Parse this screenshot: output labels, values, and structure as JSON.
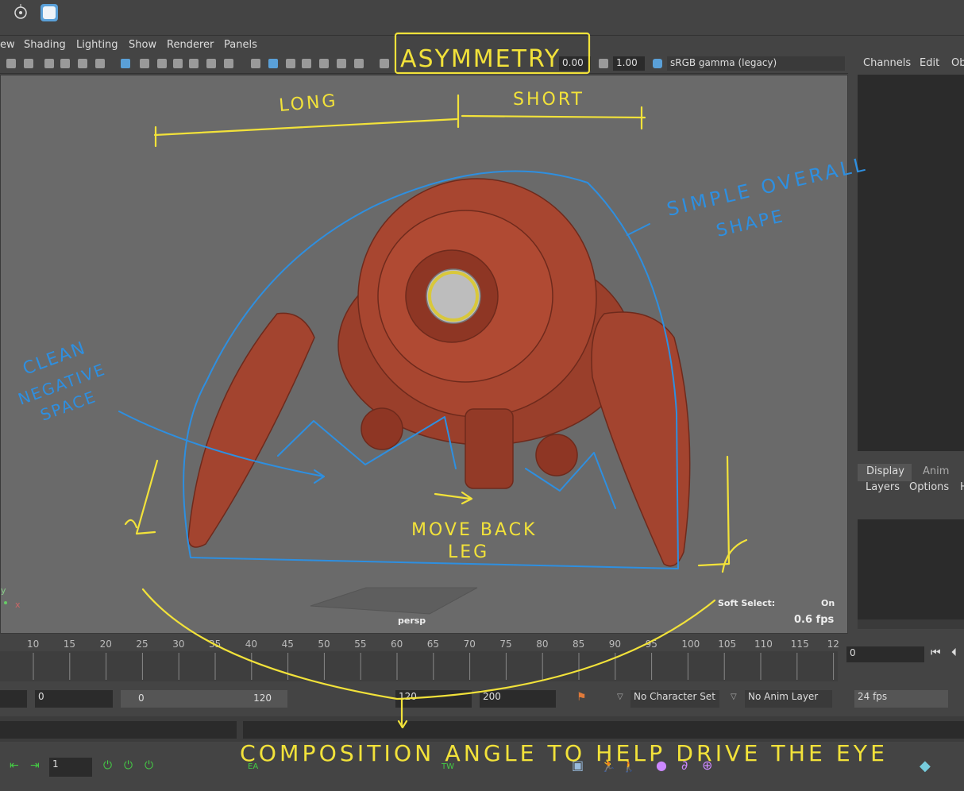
{
  "menubar": {
    "items": [
      "ew",
      "Shading",
      "Lighting",
      "Show",
      "Renderer",
      "Panels"
    ]
  },
  "toolbar": {
    "exposure_value": "0.00",
    "gamma_value": "1.00",
    "colorspace": "sRGB gamma (legacy)"
  },
  "right_panel": {
    "top_tabs": [
      "Channels",
      "Edit",
      "Ob"
    ],
    "bottom_tabs": [
      "Display",
      "Anim"
    ],
    "bottom_menu": [
      "Layers",
      "Options",
      "H"
    ]
  },
  "viewport": {
    "camera_label": "persp",
    "soft_select_label": "Soft Select:",
    "soft_select_value": "On",
    "fps_readout": "0.6 fps",
    "axis_y": "y",
    "axis_x": "x"
  },
  "annotations": {
    "asymmetry": "ASYMMETRY",
    "long": "LONG",
    "short": "SHORT",
    "simple_shape": [
      "SIMPLE OVERALL",
      "SHAPE"
    ],
    "clean_negative": [
      "CLEAN",
      "NEGATIVE",
      "SPACE"
    ],
    "move_back_leg": [
      "MOVE BACK",
      "LEG"
    ],
    "composition": "COMPOSITION ANGLE TO HELP DRIVE THE EYE",
    "colors": {
      "yellow": "#f2e23a",
      "blue": "#2e8fe0"
    }
  },
  "timeline": {
    "ticks": [
      "10",
      "15",
      "20",
      "25",
      "30",
      "35",
      "40",
      "45",
      "50",
      "55",
      "60",
      "65",
      "70",
      "75",
      "80",
      "85",
      "90",
      "95",
      "100",
      "105",
      "110",
      "115",
      "12"
    ],
    "current_frame": "0"
  },
  "range_bar": {
    "start_field": "0",
    "slider_start": "0",
    "slider_end": "120",
    "end_field": "120",
    "max_field": "200",
    "character_set": "No Character Set",
    "anim_layer": "No Anim Layer",
    "fps": "24 fps"
  },
  "shelf": {
    "frame_field": "1",
    "key_labels": [
      "EA",
      "TW"
    ]
  }
}
